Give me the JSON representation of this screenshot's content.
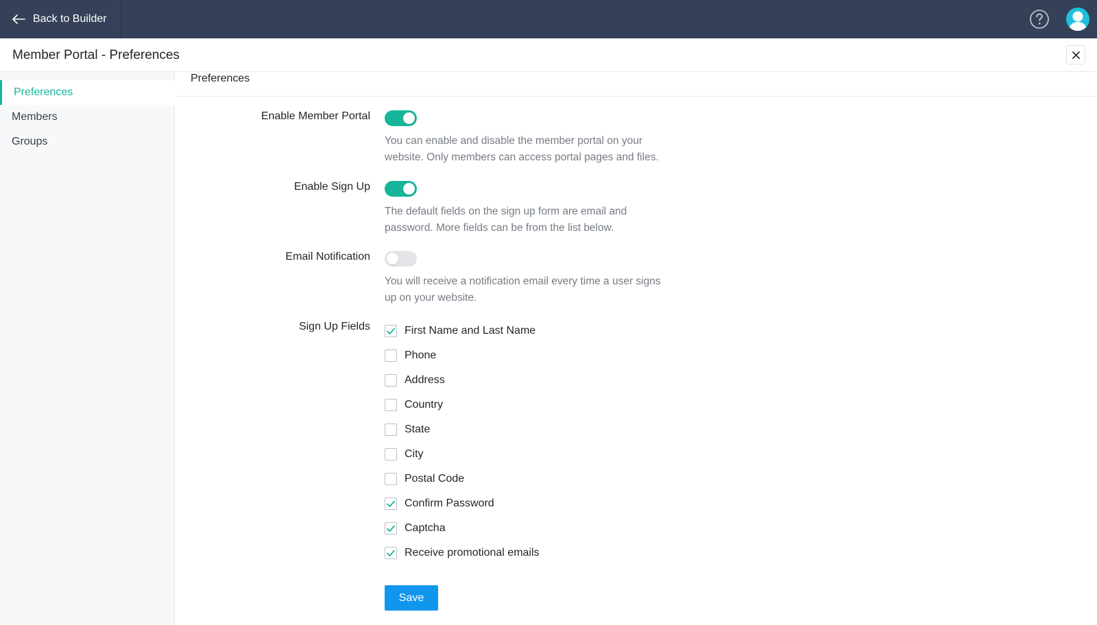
{
  "topbar": {
    "back_label": "Back to Builder",
    "icons": {
      "back": "arrow-left-icon",
      "help": "question-circle-icon",
      "avatar": "user-avatar-icon"
    }
  },
  "header": {
    "title": "Member Portal - Preferences",
    "close_icon": "close-icon"
  },
  "sidebar": {
    "items": [
      {
        "label": "Preferences",
        "active": true
      },
      {
        "label": "Members",
        "active": false
      },
      {
        "label": "Groups",
        "active": false
      }
    ]
  },
  "main": {
    "section_title": "Preferences",
    "settings": [
      {
        "label": "Enable Member Portal",
        "enabled": true,
        "help_lines": [
          "You can enable and disable the member portal on your",
          "website. Only members can access portal pages and files."
        ]
      },
      {
        "label": "Enable Sign Up",
        "enabled": true,
        "help_lines": [
          "The default fields on the sign up form are email and",
          "password. More fields can be from the list below."
        ]
      },
      {
        "label": "Email Notification",
        "enabled": false,
        "help_lines": [
          "You will receive a notification email every time a user signs",
          "up on your website."
        ]
      }
    ],
    "signup_fields_label": "Sign Up Fields",
    "signup_fields": [
      {
        "label": "First Name and Last Name",
        "checked": true
      },
      {
        "label": "Phone",
        "checked": false
      },
      {
        "label": "Address",
        "checked": false
      },
      {
        "label": "Country",
        "checked": false
      },
      {
        "label": "State",
        "checked": false
      },
      {
        "label": "City",
        "checked": false
      },
      {
        "label": "Postal Code",
        "checked": false
      },
      {
        "label": "Confirm Password",
        "checked": true
      },
      {
        "label": "Captcha",
        "checked": true
      },
      {
        "label": "Receive promotional emails",
        "checked": true
      }
    ],
    "save_label": "Save"
  },
  "colors": {
    "topbar": "#354158",
    "accent": "#17b59a",
    "primary_button": "#1196ee",
    "avatar": "#1fc0dd"
  }
}
